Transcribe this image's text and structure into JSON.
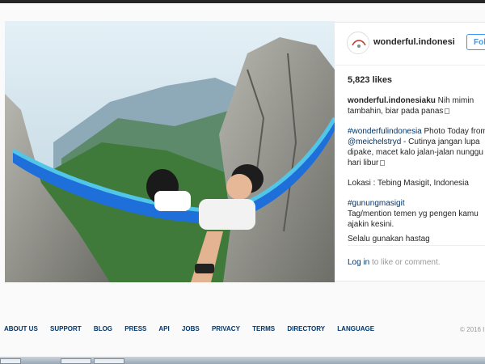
{
  "post": {
    "username": "wonderful.indonesi...",
    "follow_label": "Fol",
    "likes": "5,823 likes",
    "caption": {
      "author": "wonderful.indonesiaku",
      "line1": " Nih mimin tambahin, biar pada panas",
      "tag1": "#wonderfulindonesia",
      "text2": " Photo Today from ",
      "mention": "@meichelstryd",
      "text3": " - Cutinya jangan lupa dipake, macet kalo jalan-jalan nunggu hari libur",
      "location": "Lokasi : Tebing Masigit, Indonesia",
      "tag2": "#gunungmasigit",
      "text4": "Tag/mention temen yg pengen kamu ajakin kesini."
    },
    "comment_preview": "Selalu gunakan hastag",
    "login_link": "Log in",
    "login_rest": " to like or comment."
  },
  "footer": {
    "links": [
      "ABOUT US",
      "SUPPORT",
      "BLOG",
      "PRESS",
      "API",
      "JOBS",
      "PRIVACY",
      "TERMS",
      "DIRECTORY",
      "LANGUAGE"
    ],
    "copyright": "© 2016 I"
  },
  "colors": {
    "link": "#003569",
    "accent": "#3897f0",
    "hammock": "#1e6fd9"
  },
  "icons": {
    "avatar": "wonderful-indonesia-logo-icon"
  }
}
